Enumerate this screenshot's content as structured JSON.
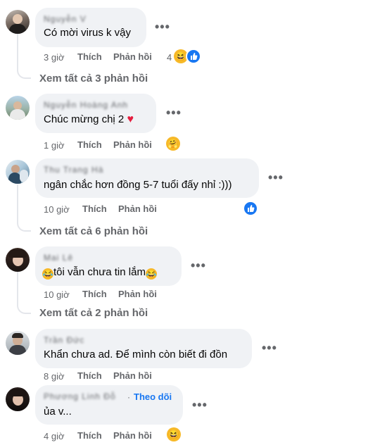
{
  "colors": {
    "bubble": "#f0f2f5",
    "muted": "#65676b",
    "link": "#1877f2",
    "heart": "#e41e3f",
    "haha": "#f7b928"
  },
  "comments": [
    {
      "name": "Nguyễn V",
      "text": "Có mời virus k vậy",
      "time": "3 giờ",
      "like_label": "Thích",
      "reply_label": "Phản hồi",
      "reaction_count": "4",
      "reactions": [
        "haha-icon",
        "like-icon"
      ],
      "view_replies": "Xem tất cả 3 phản hồi"
    },
    {
      "name": "Nguyễn Hoàng Anh",
      "text": "Chúc mừng chị 2",
      "time": "1 giờ",
      "like_label": "Thích",
      "reply_label": "Phản hồi",
      "reactions": [
        "hug-icon"
      ]
    },
    {
      "name": "Thu Trang Hà",
      "text": "ngân chắc hơn đồng 5-7 tuổi đấy nhỉ :)))",
      "time": "10 giờ",
      "like_label": "Thích",
      "reply_label": "Phản hồi",
      "reactions": [
        "like-icon"
      ],
      "view_replies": "Xem tất cả 6 phản hồi"
    },
    {
      "name": "Mai Lê",
      "text": "tôi vẫn chưa tin lắm",
      "time": "10 giờ",
      "like_label": "Thích",
      "reply_label": "Phản hồi",
      "view_replies": "Xem tất cả 2 phản hồi"
    },
    {
      "name": "Trần Đức",
      "text": "Khẩn chưa ad. Để mình còn biết đi đồn",
      "time": "8 giờ",
      "like_label": "Thích",
      "reply_label": "Phản hồi"
    },
    {
      "name": "Phương Linh Đỗ",
      "follow_label": "Theo dõi",
      "text": "ủa v...",
      "time": "4 giờ",
      "like_label": "Thích",
      "reply_label": "Phản hồi",
      "reactions": [
        "haha-icon"
      ]
    }
  ],
  "more_label": "•••"
}
